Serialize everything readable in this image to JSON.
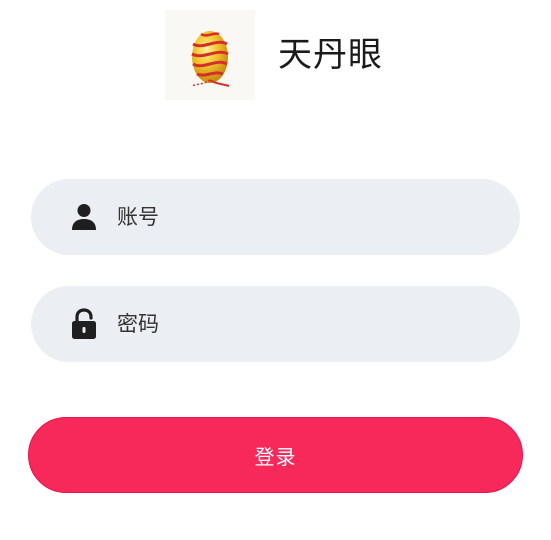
{
  "app": {
    "title": "天丹眼",
    "logo_icon": "golden-egg-logo-icon"
  },
  "form": {
    "account": {
      "icon": "user-icon",
      "placeholder": "账号",
      "value": ""
    },
    "password": {
      "icon": "lock-icon",
      "placeholder": "密码",
      "value": ""
    },
    "login_label": "登录"
  },
  "colors": {
    "accent": "#f7285a",
    "field_bg": "#ebeef3",
    "text": "#1a1a1a"
  }
}
